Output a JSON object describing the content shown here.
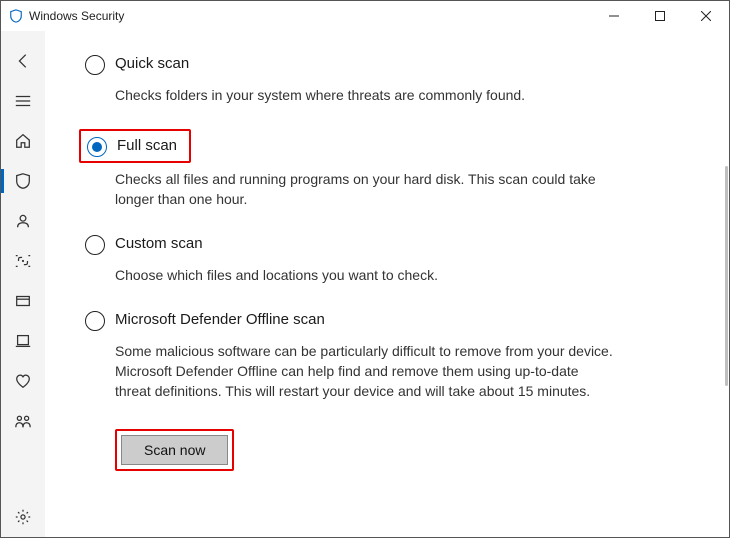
{
  "window": {
    "title": "Windows Security"
  },
  "options": [
    {
      "id": "quick",
      "title": "Quick scan",
      "desc": "Checks folders in your system where threats are commonly found.",
      "selected": false
    },
    {
      "id": "full",
      "title": "Full scan",
      "desc": "Checks all files and running programs on your hard disk. This scan could take longer than one hour.",
      "selected": true
    },
    {
      "id": "custom",
      "title": "Custom scan",
      "desc": "Choose which files and locations you want to check.",
      "selected": false
    },
    {
      "id": "offline",
      "title": "Microsoft Defender Offline scan",
      "desc": "Some malicious software can be particularly difficult to remove from your device. Microsoft Defender Offline can help find and remove them using up-to-date threat definitions. This will restart your device and will take about 15 minutes.",
      "selected": false
    }
  ],
  "actions": {
    "scan_now": "Scan now"
  }
}
